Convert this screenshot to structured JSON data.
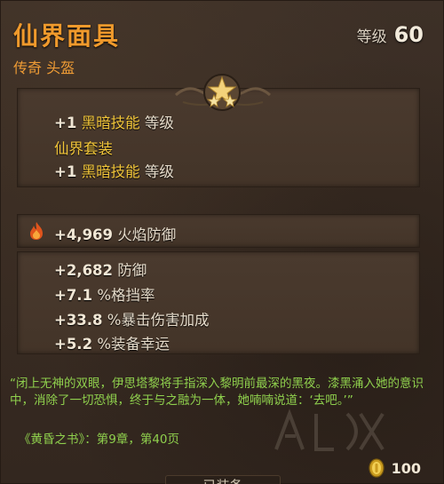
{
  "item": {
    "name": "仙界面具",
    "rarity_type": "传奇 头盔",
    "level_label": "等级",
    "level_value": "60"
  },
  "bonuses": {
    "line1_prefix": "+1",
    "line1_skill": "黑暗技能",
    "line1_suffix": "等级",
    "set_name": "仙界套装",
    "line2_prefix": "+1",
    "line2_skill": "黑暗技能",
    "line2_suffix": "等级"
  },
  "primary_stat": {
    "value": "+4,969",
    "label": "火焰防御",
    "icon": "fire-icon"
  },
  "stats": [
    {
      "value": "+2,682",
      "label": "防御"
    },
    {
      "value": "+7.1",
      "label": "%格挡率"
    },
    {
      "value": "+33.8",
      "label": "%暴击伤害加成"
    },
    {
      "value": "+5.2",
      "label": "%装备幸运"
    }
  ],
  "flavor": {
    "quote": "“闭上无神的双眼，伊思塔黎将手指深入黎明前最深的黑夜。漆黑涌入她的意识中，消除了一切恐惧，终于与之融为一体，她喃喃说道：‘去吧。’”",
    "source": "《黄昏之书》：第9章，第40页"
  },
  "price": {
    "value": "100",
    "icon": "gold-coin-icon"
  },
  "equip_button": {
    "label": "已装备"
  },
  "colors": {
    "title": "#f09a2c",
    "highlight": "#f2c63a",
    "flavor": "#8fd04d"
  }
}
